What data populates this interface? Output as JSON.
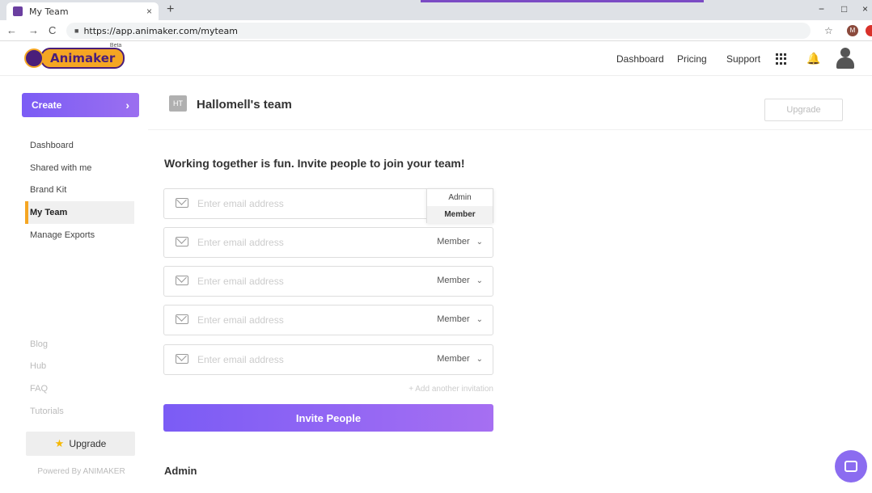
{
  "browser": {
    "tab_title": "My Team",
    "tab_close": "×",
    "new_tab": "+",
    "url": "https://app.animaker.com/myteam",
    "back": "←",
    "forward": "→",
    "reload": "C",
    "minimize": "−",
    "restore": "□",
    "close": "×",
    "star": "☆",
    "ext_m": "M"
  },
  "header": {
    "logo_text": "Animaker",
    "logo_beta": "Beta",
    "nav": [
      "Dashboard",
      "Pricing",
      "Support"
    ]
  },
  "sidebar": {
    "create_label": "Create",
    "create_chevron": "›",
    "items": [
      "Dashboard",
      "Shared with me",
      "Brand Kit",
      "My Team",
      "Manage Exports"
    ],
    "active_item": "My Team",
    "links": [
      "Blog",
      "Hub",
      "FAQ",
      "Tutorials"
    ],
    "upgrade_label": "Upgrade",
    "powered_by": "Powered By ANIMAKER"
  },
  "team": {
    "badge": "HT",
    "title": "Hallomell's team",
    "upgrade_label": "Upgrade"
  },
  "invite": {
    "heading": "Working together is fun. Invite people to join your team!",
    "email_placeholder": "Enter email address",
    "rows": [
      {
        "role": "Member"
      },
      {
        "role": "Member"
      },
      {
        "role": "Member"
      },
      {
        "role": "Member"
      },
      {
        "role": "Member"
      }
    ],
    "dropdown_options": [
      "Admin",
      "Member"
    ],
    "dropdown_selected": "Member",
    "add_another": "+ Add another invitation",
    "invite_button": "Invite People"
  },
  "admin_heading": "Admin",
  "colors": {
    "accent": "#7b5cf5",
    "active_bar": "#f5a623"
  }
}
